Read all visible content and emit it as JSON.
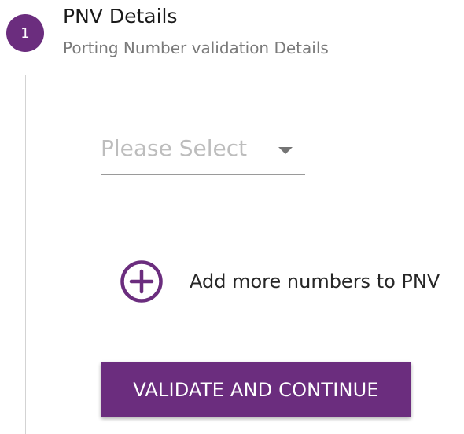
{
  "step": {
    "number": "1",
    "title": "PNV Details",
    "subtitle": "Porting Number validation Details"
  },
  "select": {
    "placeholder": "Please Select",
    "icon": "triangle-down-icon"
  },
  "add_more": {
    "icon": "plus-circle-icon",
    "label": "Add more numbers to PNV"
  },
  "primary_button": {
    "label": "VALIDATE AND CONTINUE"
  },
  "colors": {
    "accent": "#6b2d7e",
    "title_text": "#1a1a1a",
    "subtitle_text": "#7a7a7a",
    "placeholder_text": "#bdbdbd",
    "stepper_line": "#d3d3d3"
  }
}
